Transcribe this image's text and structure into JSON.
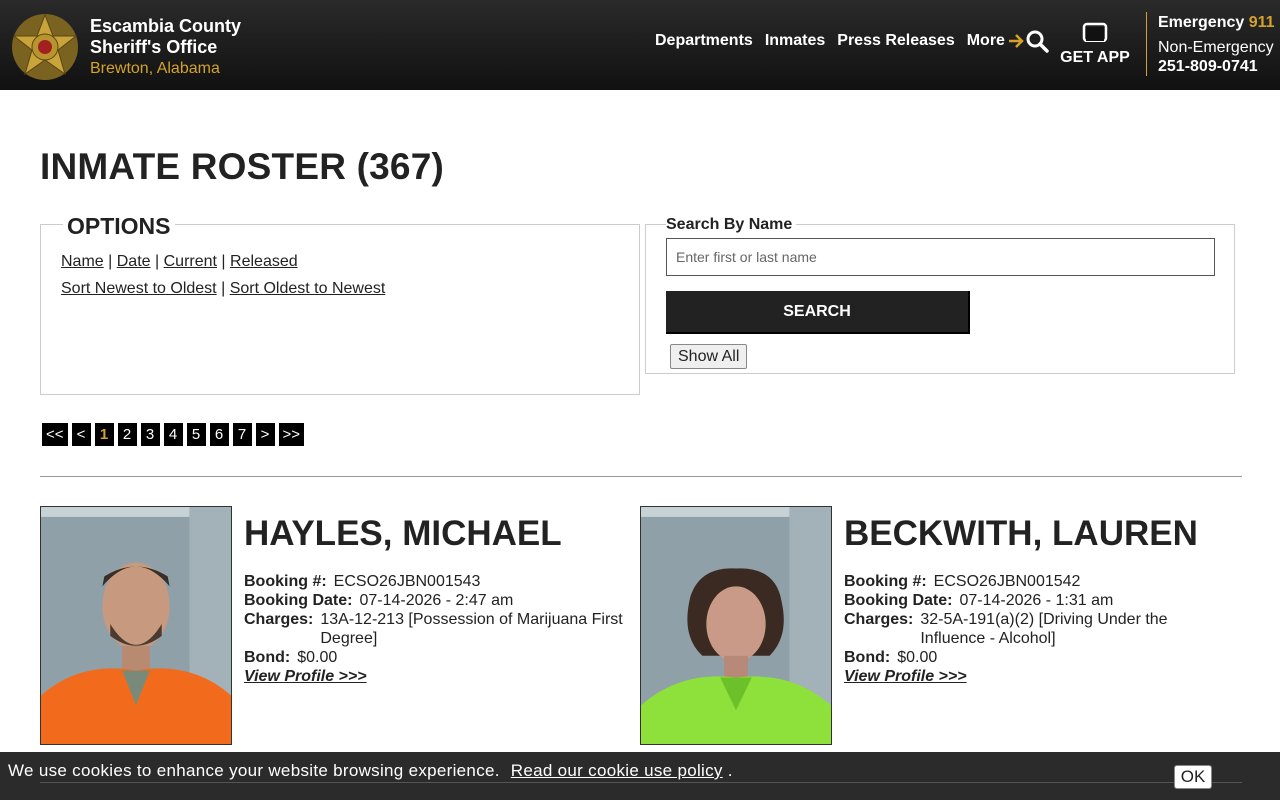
{
  "header": {
    "brand_line1": "Escambia County",
    "brand_line2": "Sheriff's Office",
    "brand_line3": "Brewton, Alabama",
    "nav": [
      "Departments",
      "Inmates",
      "Press Releases",
      "More"
    ],
    "get_app": "GET APP",
    "emergency_label": "Emergency",
    "emergency_number": "911",
    "nonemergency_label": "Non-Emergency",
    "nonemergency_phone": "251-809-0741",
    "accent_color": "#d4a22a"
  },
  "page": {
    "title": "INMATE ROSTER (367)"
  },
  "options": {
    "heading": "OPTIONS",
    "filters": [
      "Name",
      "Date",
      "Current",
      "Released"
    ],
    "sorts": [
      "Sort Newest to Oldest",
      "Sort Oldest to Newest"
    ]
  },
  "search": {
    "label": "Search By Name",
    "placeholder": "Enter first or last name",
    "button": "SEARCH",
    "show_all": "Show All"
  },
  "pager": {
    "items": [
      "<<",
      "<",
      "1",
      "2",
      "3",
      "4",
      "5",
      "6",
      "7",
      ">",
      ">>"
    ],
    "active": "1"
  },
  "inmates": [
    {
      "name": "HAYLES, MICHAEL",
      "booking_label": "Booking #:",
      "booking_no": "ECSO26JBN001543",
      "date_label": "Booking Date:",
      "booking_date": "07-14-2026 - 2:47 am",
      "charges_label": "Charges:",
      "charges": "13A-12-213 [Possession of Marijuana First Degree]",
      "bond_label": "Bond:",
      "bond": "$0.00",
      "profile_link": "View Profile >>>",
      "shirt_color": "#f26b1d"
    },
    {
      "name": "BECKWITH, LAUREN",
      "booking_label": "Booking #:",
      "booking_no": "ECSO26JBN001542",
      "date_label": "Booking Date:",
      "booking_date": "07-14-2026 - 1:31 am",
      "charges_label": "Charges:",
      "charges": "32-5A-191(a)(2) [Driving Under the Influence - Alcohol]",
      "bond_label": "Bond:",
      "bond": "$0.00",
      "profile_link": "View Profile >>>",
      "shirt_color": "#8ee03a"
    }
  ],
  "cookie": {
    "text": "We use cookies to enhance your website browsing experience.",
    "link": "Read our cookie use policy",
    "suffix": ".",
    "ok": "OK"
  }
}
